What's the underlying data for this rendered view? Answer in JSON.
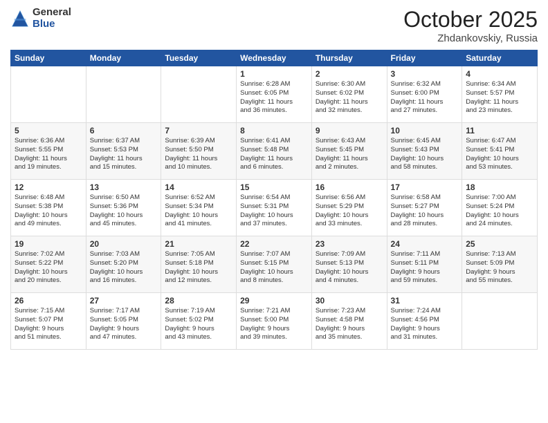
{
  "header": {
    "logo_general": "General",
    "logo_blue": "Blue",
    "month": "October 2025",
    "location": "Zhdankovskiy, Russia"
  },
  "days_of_week": [
    "Sunday",
    "Monday",
    "Tuesday",
    "Wednesday",
    "Thursday",
    "Friday",
    "Saturday"
  ],
  "weeks": [
    [
      {
        "day": "",
        "info": ""
      },
      {
        "day": "",
        "info": ""
      },
      {
        "day": "",
        "info": ""
      },
      {
        "day": "1",
        "info": "Sunrise: 6:28 AM\nSunset: 6:05 PM\nDaylight: 11 hours\nand 36 minutes."
      },
      {
        "day": "2",
        "info": "Sunrise: 6:30 AM\nSunset: 6:02 PM\nDaylight: 11 hours\nand 32 minutes."
      },
      {
        "day": "3",
        "info": "Sunrise: 6:32 AM\nSunset: 6:00 PM\nDaylight: 11 hours\nand 27 minutes."
      },
      {
        "day": "4",
        "info": "Sunrise: 6:34 AM\nSunset: 5:57 PM\nDaylight: 11 hours\nand 23 minutes."
      }
    ],
    [
      {
        "day": "5",
        "info": "Sunrise: 6:36 AM\nSunset: 5:55 PM\nDaylight: 11 hours\nand 19 minutes."
      },
      {
        "day": "6",
        "info": "Sunrise: 6:37 AM\nSunset: 5:53 PM\nDaylight: 11 hours\nand 15 minutes."
      },
      {
        "day": "7",
        "info": "Sunrise: 6:39 AM\nSunset: 5:50 PM\nDaylight: 11 hours\nand 10 minutes."
      },
      {
        "day": "8",
        "info": "Sunrise: 6:41 AM\nSunset: 5:48 PM\nDaylight: 11 hours\nand 6 minutes."
      },
      {
        "day": "9",
        "info": "Sunrise: 6:43 AM\nSunset: 5:45 PM\nDaylight: 11 hours\nand 2 minutes."
      },
      {
        "day": "10",
        "info": "Sunrise: 6:45 AM\nSunset: 5:43 PM\nDaylight: 10 hours\nand 58 minutes."
      },
      {
        "day": "11",
        "info": "Sunrise: 6:47 AM\nSunset: 5:41 PM\nDaylight: 10 hours\nand 53 minutes."
      }
    ],
    [
      {
        "day": "12",
        "info": "Sunrise: 6:48 AM\nSunset: 5:38 PM\nDaylight: 10 hours\nand 49 minutes."
      },
      {
        "day": "13",
        "info": "Sunrise: 6:50 AM\nSunset: 5:36 PM\nDaylight: 10 hours\nand 45 minutes."
      },
      {
        "day": "14",
        "info": "Sunrise: 6:52 AM\nSunset: 5:34 PM\nDaylight: 10 hours\nand 41 minutes."
      },
      {
        "day": "15",
        "info": "Sunrise: 6:54 AM\nSunset: 5:31 PM\nDaylight: 10 hours\nand 37 minutes."
      },
      {
        "day": "16",
        "info": "Sunrise: 6:56 AM\nSunset: 5:29 PM\nDaylight: 10 hours\nand 33 minutes."
      },
      {
        "day": "17",
        "info": "Sunrise: 6:58 AM\nSunset: 5:27 PM\nDaylight: 10 hours\nand 28 minutes."
      },
      {
        "day": "18",
        "info": "Sunrise: 7:00 AM\nSunset: 5:24 PM\nDaylight: 10 hours\nand 24 minutes."
      }
    ],
    [
      {
        "day": "19",
        "info": "Sunrise: 7:02 AM\nSunset: 5:22 PM\nDaylight: 10 hours\nand 20 minutes."
      },
      {
        "day": "20",
        "info": "Sunrise: 7:03 AM\nSunset: 5:20 PM\nDaylight: 10 hours\nand 16 minutes."
      },
      {
        "day": "21",
        "info": "Sunrise: 7:05 AM\nSunset: 5:18 PM\nDaylight: 10 hours\nand 12 minutes."
      },
      {
        "day": "22",
        "info": "Sunrise: 7:07 AM\nSunset: 5:15 PM\nDaylight: 10 hours\nand 8 minutes."
      },
      {
        "day": "23",
        "info": "Sunrise: 7:09 AM\nSunset: 5:13 PM\nDaylight: 10 hours\nand 4 minutes."
      },
      {
        "day": "24",
        "info": "Sunrise: 7:11 AM\nSunset: 5:11 PM\nDaylight: 9 hours\nand 59 minutes."
      },
      {
        "day": "25",
        "info": "Sunrise: 7:13 AM\nSunset: 5:09 PM\nDaylight: 9 hours\nand 55 minutes."
      }
    ],
    [
      {
        "day": "26",
        "info": "Sunrise: 7:15 AM\nSunset: 5:07 PM\nDaylight: 9 hours\nand 51 minutes."
      },
      {
        "day": "27",
        "info": "Sunrise: 7:17 AM\nSunset: 5:05 PM\nDaylight: 9 hours\nand 47 minutes."
      },
      {
        "day": "28",
        "info": "Sunrise: 7:19 AM\nSunset: 5:02 PM\nDaylight: 9 hours\nand 43 minutes."
      },
      {
        "day": "29",
        "info": "Sunrise: 7:21 AM\nSunset: 5:00 PM\nDaylight: 9 hours\nand 39 minutes."
      },
      {
        "day": "30",
        "info": "Sunrise: 7:23 AM\nSunset: 4:58 PM\nDaylight: 9 hours\nand 35 minutes."
      },
      {
        "day": "31",
        "info": "Sunrise: 7:24 AM\nSunset: 4:56 PM\nDaylight: 9 hours\nand 31 minutes."
      },
      {
        "day": "",
        "info": ""
      }
    ]
  ]
}
